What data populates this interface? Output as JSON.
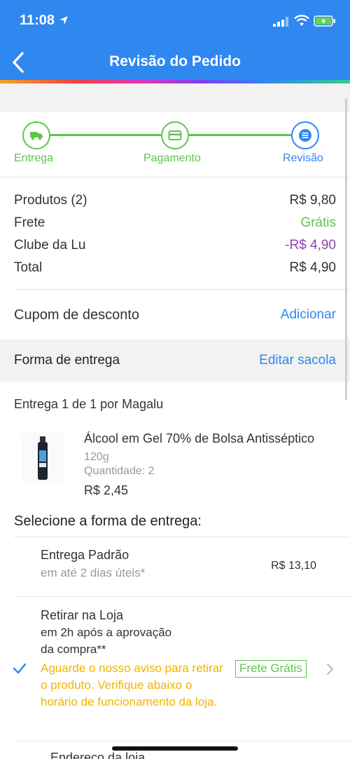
{
  "status_bar": {
    "time": "11:08"
  },
  "nav": {
    "title": "Revisão do Pedido",
    "back_icon": "chevron-left-icon"
  },
  "stepper": {
    "steps": [
      {
        "label": "Entrega",
        "icon": "truck-icon"
      },
      {
        "label": "Pagamento",
        "icon": "card-icon"
      },
      {
        "label": "Revisão",
        "icon": "list-icon"
      }
    ],
    "completed_color": "#5cc64b",
    "active_color": "#2f87f0"
  },
  "summary": {
    "rows": [
      {
        "label": "Produtos (2)",
        "value": "R$ 9,80"
      },
      {
        "label": "Frete",
        "value": "Grátis"
      },
      {
        "label": "Clube da Lu",
        "value": "-R$ 4,90"
      },
      {
        "label": "Total",
        "value": "R$ 4,90"
      }
    ]
  },
  "coupon": {
    "label": "Cupom de desconto",
    "action": "Adicionar"
  },
  "delivery_section": {
    "title": "Forma de entrega",
    "action": "Editar sacola"
  },
  "shipment": {
    "header_bold": "Entrega 1 de 1",
    "header_rest": " por Magalu",
    "product": {
      "name": "Álcool em Gel 70% de Bolsa Antisséptico",
      "size": "120g",
      "quantity": "Quantidade: 2",
      "price": "R$ 2,45"
    }
  },
  "delivery_options": {
    "title": "Selecione a forma de entrega:",
    "options": [
      {
        "title": "Entrega Padrão",
        "subtitle": "em até 2 dias úteis*",
        "price": "R$ 13,10"
      },
      {
        "title": "Retirar na Loja",
        "subtitle_line1": "em 2h após a aprovação",
        "subtitle_line2": "da compra**",
        "notice": "Aguarde o nosso aviso para retirar o produto. Verifique abaixo o horário de funcionamento da loja.",
        "badge": "Frete Grátis",
        "selected": true
      }
    ],
    "next_partial": "Endereço da loja"
  },
  "colors": {
    "primary": "#2f87f0",
    "green": "#5cc64b",
    "purple": "#8e44ad",
    "yellow_notice": "#f0b400"
  }
}
